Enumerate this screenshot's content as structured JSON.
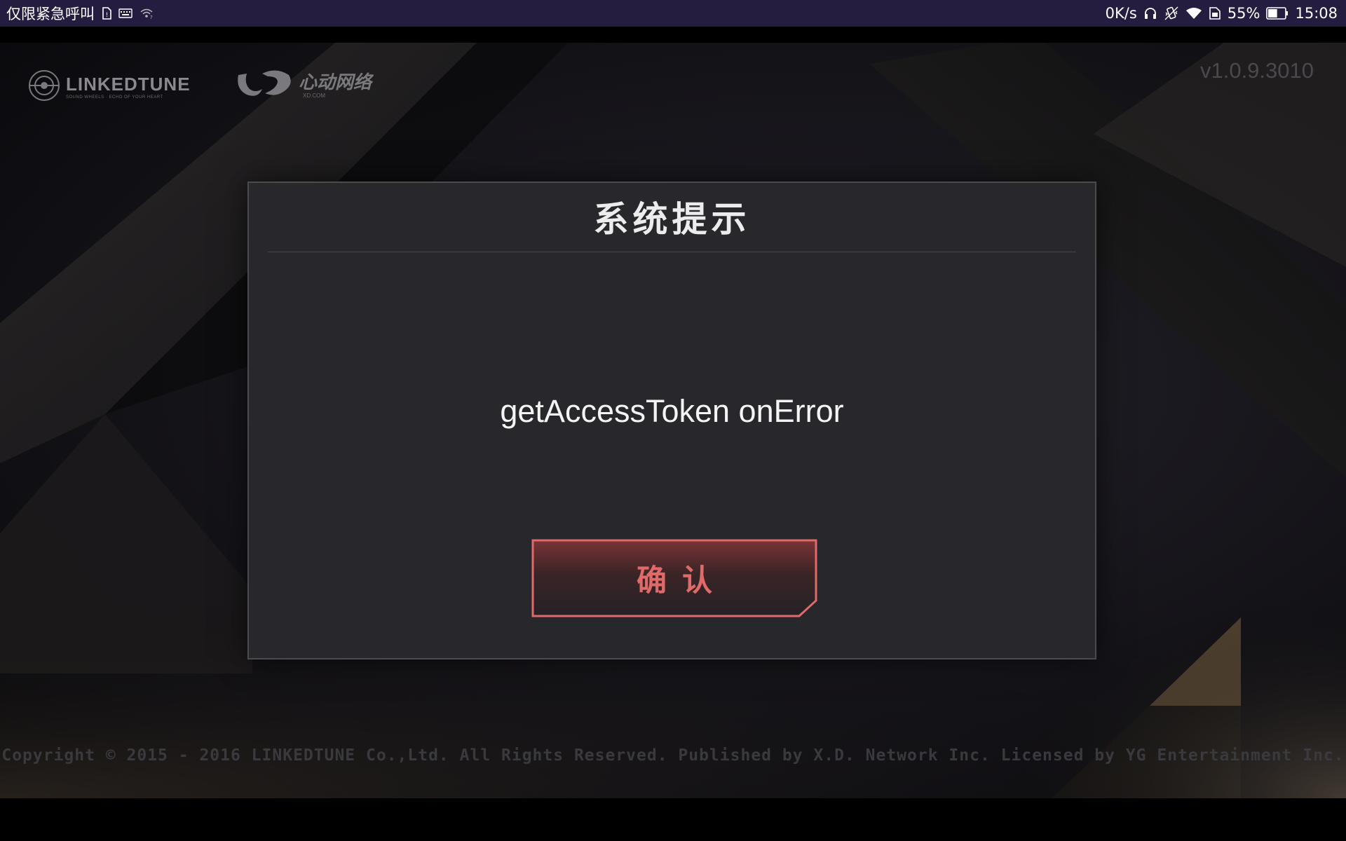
{
  "status_bar": {
    "carrier_text": "仅限紧急呼叫",
    "net_speed": "0K/s",
    "battery_percent": "55%",
    "battery_level": 0.55,
    "time": "15:08",
    "left_icons": [
      "sim-icon",
      "keyboard-icon",
      "wifi-hotspot-icon"
    ],
    "right_icons": [
      "headset-icon",
      "vibrate-icon",
      "wifi-icon",
      "sim-card-icon",
      "battery-icon"
    ]
  },
  "game": {
    "brand_name": "LINKEDTUNE",
    "brand_tagline": "SOUND WHEELS · ECHO OF YOUR HEART",
    "publisher_logo_text": "心动网络",
    "publisher_domain": "XD.COM",
    "version": "v1.0.9.3010",
    "copyright": "Copyright © 2015 - 2016 LINKEDTUNE Co.,Ltd. All Rights Reserved. Published by X.D. Network Inc. Licensed by YG Entertainment Inc."
  },
  "dialog": {
    "title": "系统提示",
    "message": "getAccessToken onError",
    "confirm_label": "确认"
  },
  "colors": {
    "status_bar_bg": "#241d40",
    "dialog_bg": "#27272c",
    "button_accent": "#e06a6a"
  }
}
